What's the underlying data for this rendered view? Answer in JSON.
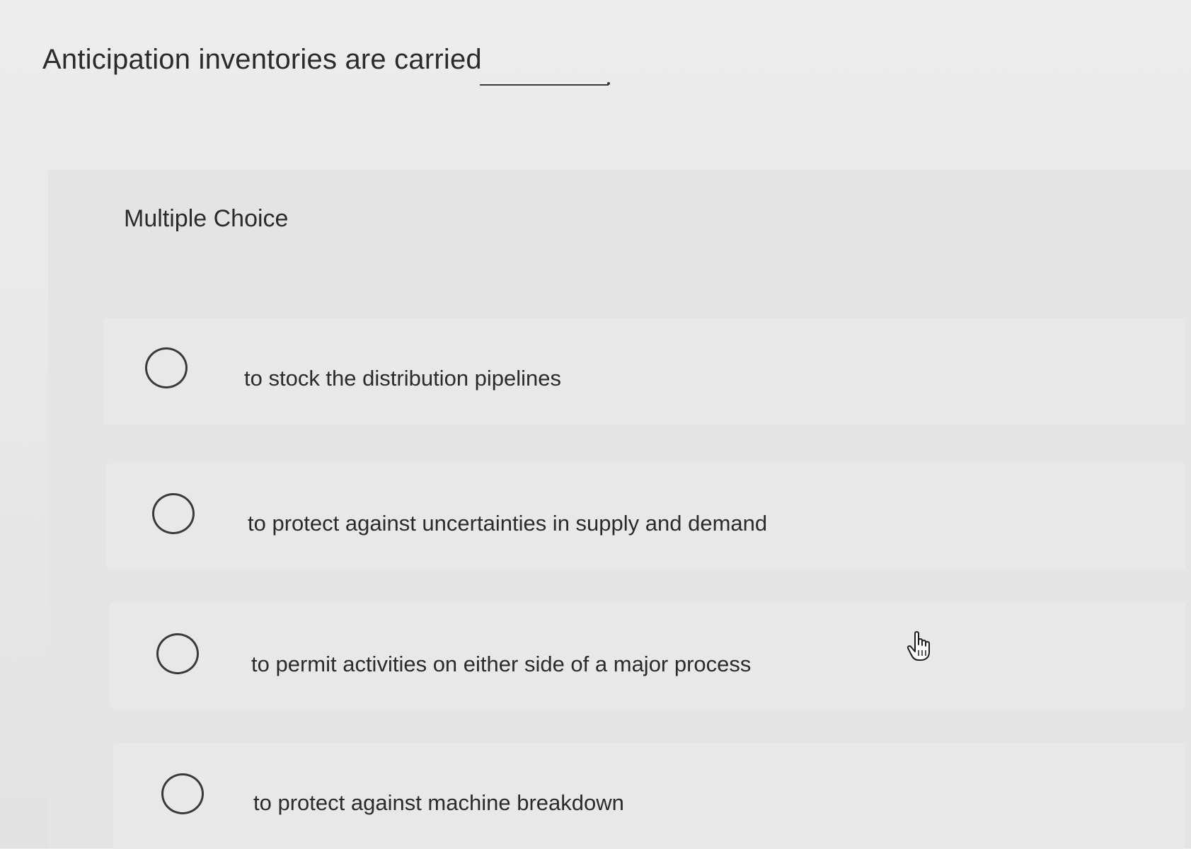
{
  "question": {
    "text": "Anticipation inventories are carried",
    "blank_terminator": "."
  },
  "panel": {
    "label": "Multiple Choice"
  },
  "options": [
    {
      "label": "to stock the distribution pipelines",
      "selected": false
    },
    {
      "label": "to protect against uncertainties in supply and demand",
      "selected": false
    },
    {
      "label": "to permit activities on either side of a major process",
      "selected": false
    },
    {
      "label": "to protect against machine breakdown",
      "selected": false
    }
  ],
  "cursor": {
    "icon": "hand-pointer-icon"
  }
}
